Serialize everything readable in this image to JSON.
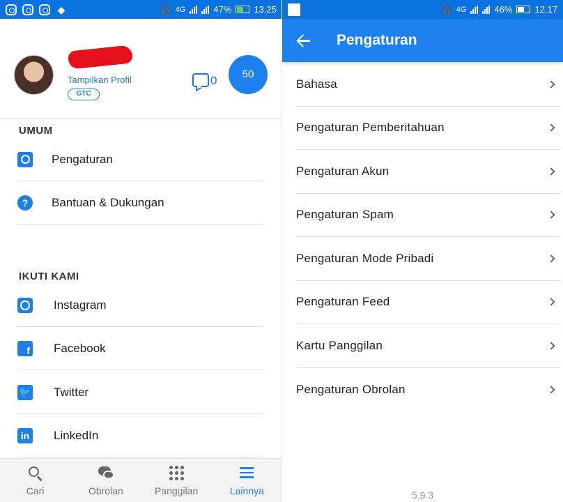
{
  "left": {
    "status_bar": {
      "network": "4G",
      "battery": "47%",
      "time": "13.25",
      "sim1": "1",
      "sim2": "2"
    },
    "profile": {
      "view_profile": "Tampilkan Profil",
      "badge": "GTC",
      "message_count": "0",
      "coin_count": "50"
    },
    "sections": {
      "general": "UMUM",
      "follow": "IKUTI KAMI"
    },
    "general_items": [
      {
        "label": "Pengaturan",
        "icon": "gear-icon"
      },
      {
        "label": "Bantuan & Dukungan",
        "icon": "help-icon"
      }
    ],
    "follow_items": [
      {
        "label": "Instagram",
        "icon": "instagram-icon"
      },
      {
        "label": "Facebook",
        "icon": "facebook-icon"
      },
      {
        "label": "Twitter",
        "icon": "twitter-icon"
      },
      {
        "label": "LinkedIn",
        "icon": "linkedin-icon"
      }
    ],
    "bottom_nav": [
      {
        "label": "Cari",
        "icon": "search-icon"
      },
      {
        "label": "Obrolan",
        "icon": "chat-icon"
      },
      {
        "label": "Panggilan",
        "icon": "dialpad-icon"
      },
      {
        "label": "Lainnya",
        "icon": "menu-icon",
        "active": true
      }
    ]
  },
  "right": {
    "status_bar": {
      "network": "4G",
      "battery": "46%",
      "time": "12.17",
      "sim1": "1",
      "sim2": "2"
    },
    "appbar": {
      "title": "Pengaturan"
    },
    "settings_items": [
      {
        "label": "Bahasa"
      },
      {
        "label": "Pengaturan Pemberitahuan"
      },
      {
        "label": "Pengaturan Akun"
      },
      {
        "label": "Pengaturan Spam"
      },
      {
        "label": "Pengaturan Mode Pribadi"
      },
      {
        "label": "Pengaturan Feed"
      },
      {
        "label": "Kartu Panggilan"
      },
      {
        "label": "Pengaturan Obrolan"
      }
    ],
    "version": "5.9.3"
  },
  "colors": {
    "accent": "#1e82ee",
    "status_bar": "#0a73e0"
  }
}
